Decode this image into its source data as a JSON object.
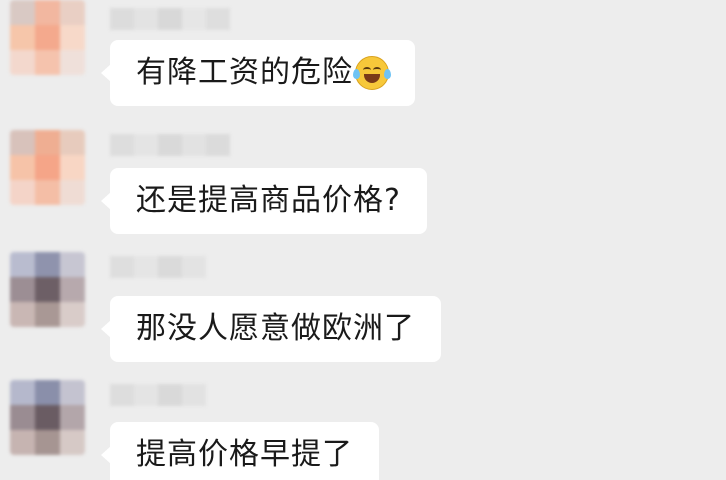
{
  "chat": {
    "messages": [
      {
        "text": "有降工资的危险",
        "emoji": "tears-of-joy-emoji"
      },
      {
        "text": "还是提高商品价格?"
      },
      {
        "text": "那没人愿意做欧洲了"
      },
      {
        "text": "提高价格早提了"
      }
    ]
  },
  "colors": {
    "background": "#ededed",
    "bubble": "#ffffff",
    "text": "#1a1a1a"
  },
  "privacy": {
    "avatars": "pixelated",
    "names": "pixelated"
  }
}
